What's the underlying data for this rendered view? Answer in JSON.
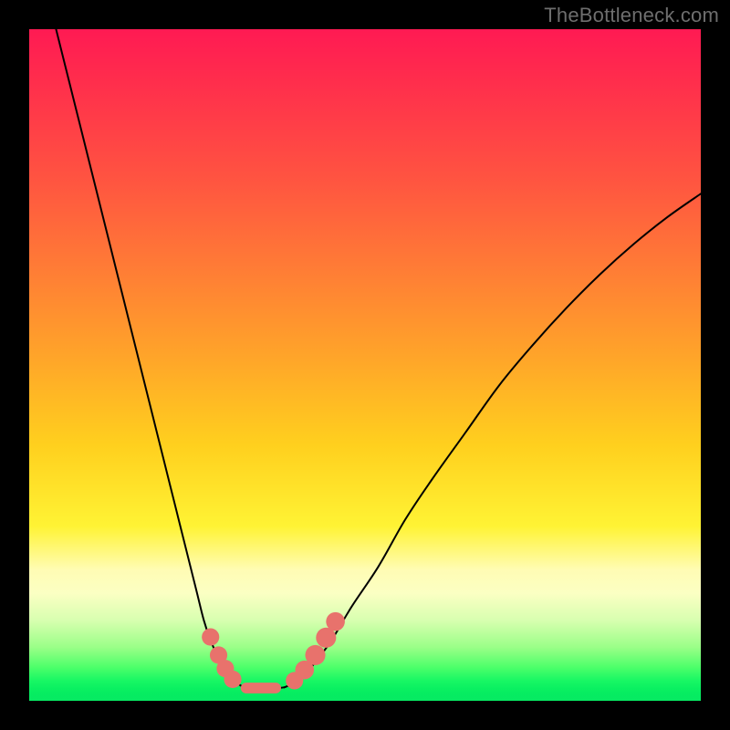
{
  "watermark": "TheBottleneck.com",
  "chart_data": {
    "type": "line",
    "title": "",
    "xlabel": "",
    "ylabel": "",
    "xlim": [
      0,
      100
    ],
    "ylim": [
      0,
      100
    ],
    "grid": false,
    "legend": false,
    "series": [
      {
        "name": "left-curve",
        "color": "#000000",
        "x": [
          4,
          6,
          8,
          10,
          12,
          14,
          16,
          18,
          20,
          22,
          24,
          25,
          26,
          27,
          28,
          29,
          30,
          31,
          32
        ],
        "y": [
          100,
          92,
          84,
          76,
          68,
          60,
          52,
          44,
          36,
          28,
          20,
          16,
          12,
          9,
          6.8,
          5,
          3.6,
          2.6,
          2
        ]
      },
      {
        "name": "right-curve",
        "color": "#000000",
        "x": [
          38,
          40,
          42,
          45,
          48,
          52,
          56,
          60,
          65,
          70,
          75,
          80,
          85,
          90,
          95,
          100
        ],
        "y": [
          2,
          3,
          5,
          9,
          14,
          20,
          27,
          33,
          40,
          47,
          53,
          58.5,
          63.5,
          68,
          72,
          75.5
        ]
      },
      {
        "name": "flat-minimum",
        "color": "#000000",
        "x": [
          32,
          33,
          34,
          35,
          36,
          37,
          38
        ],
        "y": [
          2,
          1.9,
          1.85,
          1.85,
          1.85,
          1.9,
          2
        ]
      }
    ],
    "markers": [
      {
        "name": "left-dot-upper",
        "x": 27.0,
        "y": 9.5,
        "r": 1.3,
        "color": "#e8726c"
      },
      {
        "name": "left-dot-mid",
        "x": 28.2,
        "y": 6.8,
        "r": 1.3,
        "color": "#e8726c"
      },
      {
        "name": "left-dot-low",
        "x": 29.2,
        "y": 4.8,
        "r": 1.3,
        "color": "#e8726c"
      },
      {
        "name": "left-dot-bottom",
        "x": 30.3,
        "y": 3.2,
        "r": 1.3,
        "color": "#e8726c"
      },
      {
        "name": "flat-pill",
        "x": 34.5,
        "y": 1.9,
        "w": 6.0,
        "h": 1.6,
        "shape": "pill",
        "color": "#e8726c"
      },
      {
        "name": "right-dot-bottom",
        "x": 39.5,
        "y": 3.0,
        "r": 1.3,
        "color": "#e8726c"
      },
      {
        "name": "right-dot-low",
        "x": 41.0,
        "y": 4.6,
        "r": 1.4,
        "color": "#e8726c"
      },
      {
        "name": "right-dot-mid",
        "x": 42.6,
        "y": 6.8,
        "r": 1.5,
        "color": "#e8726c"
      },
      {
        "name": "right-dot-upper",
        "x": 44.2,
        "y": 9.4,
        "r": 1.5,
        "color": "#e8726c"
      },
      {
        "name": "right-dot-top",
        "x": 45.6,
        "y": 11.8,
        "r": 1.4,
        "color": "#e8726c"
      }
    ],
    "background": {
      "type": "vertical-gradient",
      "stops": [
        {
          "pos": 0,
          "color": "#ff1a53"
        },
        {
          "pos": 0.35,
          "color": "#ff7a36"
        },
        {
          "pos": 0.62,
          "color": "#ffd01e"
        },
        {
          "pos": 0.82,
          "color": "#fffcb4"
        },
        {
          "pos": 0.92,
          "color": "#9bff88"
        },
        {
          "pos": 1.0,
          "color": "#07ea62"
        }
      ]
    }
  }
}
